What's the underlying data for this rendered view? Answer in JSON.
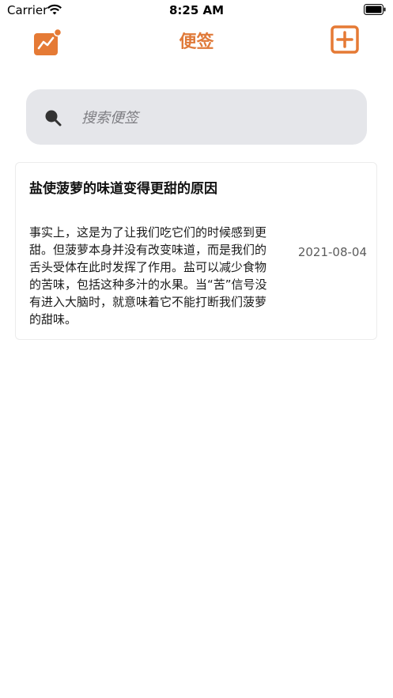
{
  "status_bar": {
    "carrier": "Carrier",
    "time": "8:25 AM"
  },
  "nav": {
    "title": "便签",
    "accent_color": "#e07a3a",
    "left_icon": "stats-chart-icon",
    "right_icon": "add-square-icon"
  },
  "search": {
    "placeholder": "搜索便签",
    "value": ""
  },
  "notes": [
    {
      "title": "盐使菠萝的味道变得更甜的原因",
      "body": "事实上，这是为了让我们吃它们的时候感到更甜。但菠萝本身并没有改变味道，而是我们的舌头受体在此时发挥了作用。盐可以减少食物的苦味，包括这种多汁的水果。当“苦”信号没有进入大脑时，就意味着它不能打断我们菠萝的甜味。",
      "date": "2021-08-04"
    }
  ]
}
